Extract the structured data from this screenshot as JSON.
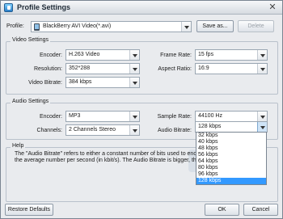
{
  "window": {
    "title": "Profile Settings",
    "close_glyph": "✕"
  },
  "profile": {
    "label": "Profile:",
    "value": "BlackBerry AVI Video(*.avi)",
    "save_as": "Save as...",
    "delete": "Delete"
  },
  "video": {
    "group": "Video Settings",
    "encoder_label": "Encoder:",
    "encoder_value": "H.263 Video",
    "resolution_label": "Resolution:",
    "resolution_value": "352*288",
    "bitrate_label": "Video Bitrate:",
    "bitrate_value": "384 kbps",
    "framerate_label": "Frame Rate:",
    "framerate_value": "15 fps",
    "aspect_label": "Aspect Ratio:",
    "aspect_value": "16:9"
  },
  "audio": {
    "group": "Audio Settings",
    "encoder_label": "Encoder:",
    "encoder_value": "MP3",
    "channels_label": "Channels:",
    "channels_value": "2 Channels Stereo",
    "samplerate_label": "Sample Rate:",
    "samplerate_value": "44100 Hz",
    "bitrate_label": "Audio Bitrate:",
    "bitrate_value": "128 kbps",
    "bitrate_options": [
      "32 kbps",
      "40 kbps",
      "48 kbps",
      "56 kbps",
      "64 kbps",
      "80 kbps",
      "96 kbps",
      "128 kbps"
    ],
    "selected_index": 7
  },
  "help": {
    "group": "Help",
    "line1": "The \"Audio Bitrate\" refers to either a constant number of bits used to encode",
    "line2": "the average number per second (in kbit/s). The Audio Bitrate is bigger, the"
  },
  "footer": {
    "restore": "Restore Defaults",
    "ok": "OK",
    "cancel": "Cancel"
  }
}
